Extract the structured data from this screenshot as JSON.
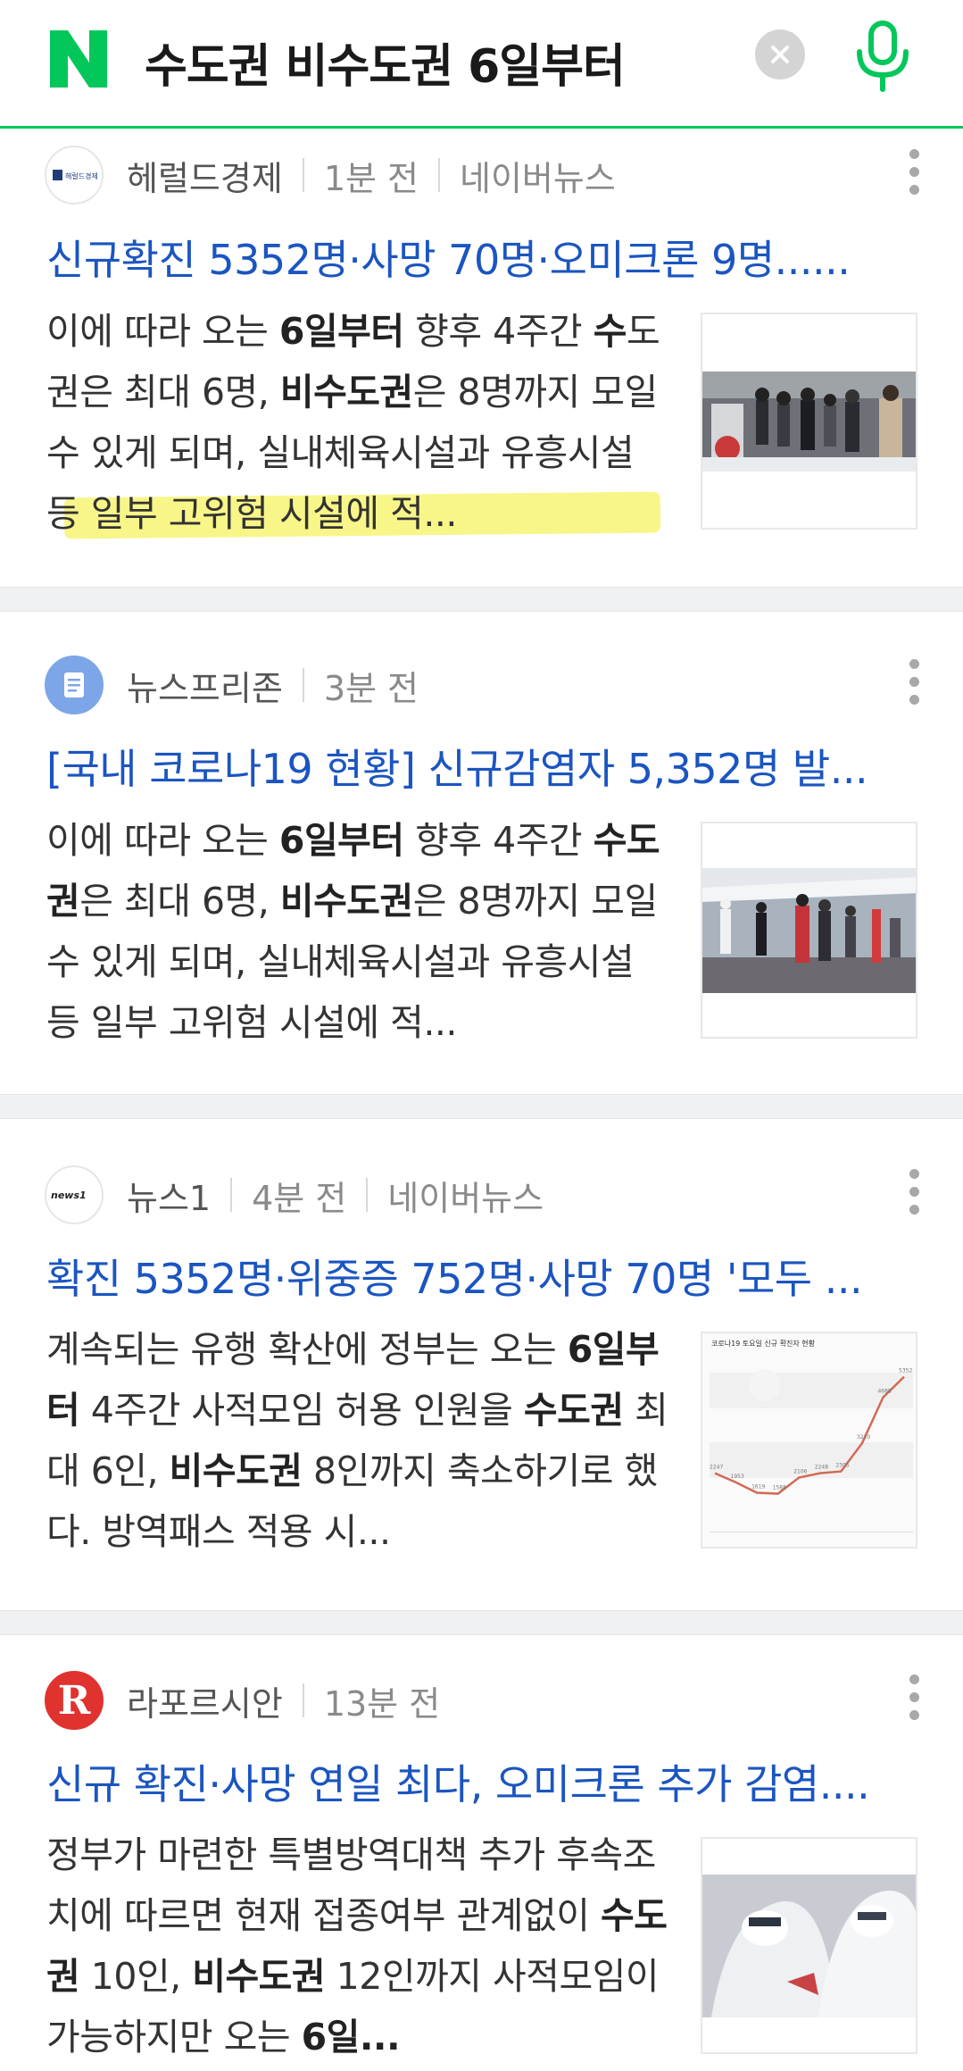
{
  "search": {
    "query": "수도권 비수도권 6일부터"
  },
  "articles": [
    {
      "press": "헤럴드경제",
      "logo_text": "헤럴드경제",
      "time": "1분 전",
      "source": "네이버뉴스",
      "title": "신규확진 5352명·사망 70명·오미크론 9명......",
      "body_parts": [
        {
          "t": "이에 따라 오는 ",
          "b": false
        },
        {
          "t": "6일부터",
          "b": true
        },
        {
          "t": " 향후 4주간 ",
          "b": false
        },
        {
          "t": "수",
          "b": true
        },
        {
          "t": "도권",
          "b": false
        },
        {
          "t": "은 최대 6명, ",
          "b": false
        },
        {
          "t": "비수도권",
          "b": true
        },
        {
          "t": "은 8명까지 모일 수 있게 되며, 실내체육시설과 유흥시설 등 일부 고위험 시설에 적...",
          "b": false
        }
      ]
    },
    {
      "press": "뉴스프리존",
      "time": "3분 전",
      "title": "[국내 코로나19 현황] 신규감염자 5,352명 발...",
      "body_parts": [
        {
          "t": "이에 따라 오는 ",
          "b": false
        },
        {
          "t": "6일부터",
          "b": true
        },
        {
          "t": " 향후 4주간 ",
          "b": false
        },
        {
          "t": "수도권",
          "b": true
        },
        {
          "t": "은 최대 6명, ",
          "b": false
        },
        {
          "t": "비수도권",
          "b": true
        },
        {
          "t": "은 8명까지 모일 수 있게 되며, 실내체육시설과 유흥시설 등 일부 고위험 시설에 적...",
          "b": false
        }
      ]
    },
    {
      "press": "뉴스1",
      "logo_text": "news1",
      "time": "4분 전",
      "source": "네이버뉴스",
      "title": "확진 5352명·위중증 752명·사망 70명 '모두 ...",
      "thumb_chart": {
        "title": "코로나19 토요일 신규 확진자 현황",
        "values": [
          "2247",
          "1953",
          "1619",
          "1588",
          "2106",
          "2248",
          "2305",
          "3210",
          "4688",
          "5352"
        ]
      },
      "body_parts": [
        {
          "t": "계속되는 유행 확산에 정부는 오는 ",
          "b": false
        },
        {
          "t": "6일부터",
          "b": true
        },
        {
          "t": " 4주간 사적모임 허용 인원을 ",
          "b": false
        },
        {
          "t": "수도권",
          "b": true
        },
        {
          "t": " 최대 6인, ",
          "b": false
        },
        {
          "t": "비수도권",
          "b": true
        },
        {
          "t": " 8인까지 축소하기로 했다. 방역패스 적용 시...",
          "b": false
        }
      ]
    },
    {
      "press": "라포르시안",
      "logo_text": "R",
      "time": "13분 전",
      "title": "신규 확진·사망 연일 최다, 오미크론 추가 감염....",
      "body_parts": [
        {
          "t": "정부가 마련한 특별방역대책 추가 후속조치에 따르면 현재 접종여부 관계없이 ",
          "b": false
        },
        {
          "t": "수도권",
          "b": true
        },
        {
          "t": " 10인, ",
          "b": false
        },
        {
          "t": "비수도권",
          "b": true
        },
        {
          "t": " 12인까지 사적모임이 가능하지만 오는 ",
          "b": false
        },
        {
          "t": "6일...",
          "b": true
        }
      ]
    }
  ],
  "colors": {
    "naver_green": "#03c75a",
    "title_blue": "#1b55c0",
    "highlight": "#f6f040"
  }
}
